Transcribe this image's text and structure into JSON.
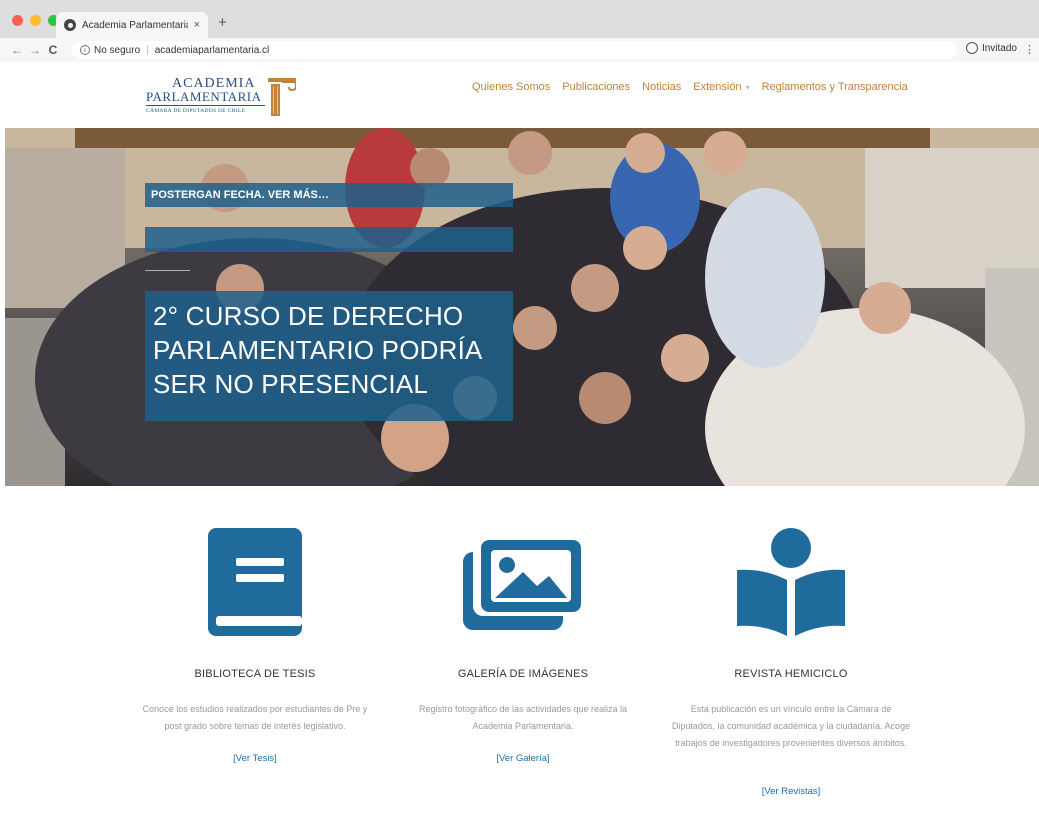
{
  "browser": {
    "tab_title": "Academia Parlamentaria – Cám",
    "tab_close": "×",
    "new_tab": "+",
    "security_label": "No seguro",
    "url": "academiaparlamentaria.cl",
    "profile_label": "Invitado",
    "back": "←",
    "forward": "→",
    "reload": "C"
  },
  "logo": {
    "line1": "ACADEMIA",
    "line2": "PARLAMENTARIA",
    "line3": "CÁMARA DE DIPUTADOS DE CHILE"
  },
  "nav": {
    "items": [
      "Quienes Somos",
      "Publicaciones",
      "Noticias",
      "Extensión",
      "Reglamentos y Transparencia"
    ]
  },
  "hero": {
    "kicker": "POSTERGAN FECHA. VER MÁS…",
    "headline": "2° CURSO DE DERECHO PARLAMENTARIO PODRÍA SER NO PRESENCIAL"
  },
  "features": [
    {
      "title": "BIBLIOTECA DE TESIS",
      "text": "Conoce los estudios realizados por estudiantes de Pre y post grado sobre temas de interés legislativo.",
      "link": "[Ver Tesis]"
    },
    {
      "title": "GALERÍA DE IMÁGENES",
      "text": "Registro fotográfico de las actividades que realiza la Academia Parlamentaria.",
      "link": "[Ver Galería]"
    },
    {
      "title": "REVISTA HEMICICLO",
      "text": "Esta publicación es un vínculo entre la Cámara de Diputados, la comunidad académica y la ciudadanía. Acoge trabajos de investigadores provenientes diversos ámbitos.",
      "link": "[Ver Revistas]"
    }
  ],
  "colors": {
    "accent_blue": "#1f6c9c",
    "nav_gold": "#c0833a",
    "logo_blue": "#2b4e86"
  }
}
